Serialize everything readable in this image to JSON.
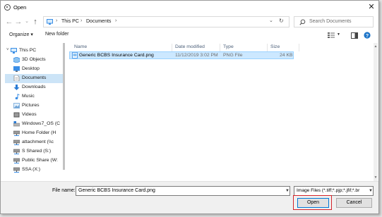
{
  "window": {
    "title": "Open"
  },
  "address": {
    "path": [
      "This PC",
      "Documents"
    ]
  },
  "search": {
    "placeholder": "Search Documents"
  },
  "toolbar": {
    "organize_label": "Organize ▾",
    "new_folder_label": "New folder"
  },
  "sidebar": {
    "items": [
      {
        "label": "This PC",
        "icon": "pc-icon",
        "color": "#3a8ee6"
      },
      {
        "label": "3D Objects",
        "icon": "cube-icon",
        "color": "#5aa7e8"
      },
      {
        "label": "Desktop",
        "icon": "desktop-icon",
        "color": "#3a8ee6"
      },
      {
        "label": "Documents",
        "icon": "document-icon",
        "color": "#8a8a8a",
        "selected": true
      },
      {
        "label": "Downloads",
        "icon": "download-icon",
        "color": "#2a7bd4"
      },
      {
        "label": "Music",
        "icon": "music-icon",
        "color": "#3a8ee6"
      },
      {
        "label": "Pictures",
        "icon": "pictures-icon",
        "color": "#6fa3d6"
      },
      {
        "label": "Videos",
        "icon": "video-icon",
        "color": "#555555"
      },
      {
        "label": "Windows7_OS (C",
        "icon": "drive-icon",
        "color": "#8a8a8a"
      },
      {
        "label": "Home Folder (H",
        "icon": "network-drive-icon",
        "color": "#555555"
      },
      {
        "label": "attachment (\\\\c",
        "icon": "network-drive-icon",
        "color": "#555555"
      },
      {
        "label": "S Shared (S:)",
        "icon": "network-drive-icon",
        "color": "#555555"
      },
      {
        "label": "Public Share (W:",
        "icon": "network-drive-icon",
        "color": "#555555"
      },
      {
        "label": "SSA (X:)",
        "icon": "network-drive-icon",
        "color": "#555555"
      }
    ]
  },
  "file_list": {
    "columns": [
      "Name",
      "Date modified",
      "Type",
      "Size"
    ],
    "rows": [
      {
        "name": "Generic BCBS Insurance Card.png",
        "date": "11/12/2019 3:02 PM",
        "type": "PNG File",
        "size": "24 KB"
      }
    ]
  },
  "footer": {
    "file_name_label": "File name:",
    "file_name_value": "Generic BCBS Insurance Card.png",
    "file_type_value": "Image Files (*.tiff;*.pjp;*.jfif;*.br",
    "open_label": "Open",
    "cancel_label": "Cancel"
  },
  "colors": {
    "selection": "#cce8ff",
    "highlight_box": "#d3232a",
    "accent": "#0078d7"
  }
}
